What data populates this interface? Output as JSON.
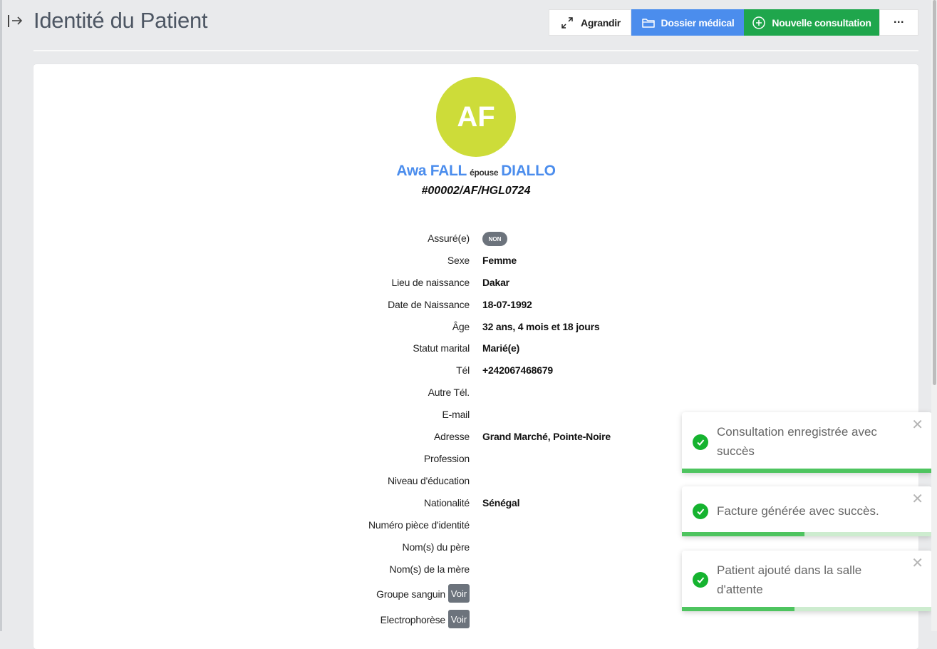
{
  "header": {
    "title": "Identité du Patient"
  },
  "toolbar": {
    "agrandir_label": "Agrandir",
    "dossier_label": "Dossier médical",
    "consultation_label": "Nouvelle consultation",
    "more_label": "···"
  },
  "patient": {
    "initials": "AF",
    "first_name": "Awa FALL",
    "epouse_label": "épouse",
    "spouse_name": "DIALLO",
    "id": "#00002/AF/HGL0724"
  },
  "fields": {
    "assure_label": "Assuré(e)",
    "assure_badge": "NON",
    "sexe_label": "Sexe",
    "sexe_value": "Femme",
    "lieu_label": "Lieu de naissance",
    "lieu_value": "Dakar",
    "date_label": "Date de Naissance",
    "date_value": "18-07-1992",
    "age_label": "Âge",
    "age_value": "32 ans, 4 mois et 18 jours",
    "statut_label": "Statut marital",
    "statut_value": "Marié(e)",
    "tel_label": "Tél",
    "tel_value": "+242067468679",
    "autre_tel_label": "Autre Tél.",
    "email_label": "E-mail",
    "adresse_label": "Adresse",
    "adresse_value": "Grand Marché, Pointe-Noire",
    "profession_label": "Profession",
    "niveau_label": "Niveau d'éducation",
    "nationalite_label": "Nationalité",
    "nationalite_value": "Sénégal",
    "piece_label": "Numéro pièce d'identité",
    "pere_label": "Nom(s) du père",
    "mere_label": "Nom(s) de la mère",
    "groupe_label": "Groupe sanguin",
    "electro_label": "Electrophorèse",
    "voir_label": "Voir"
  },
  "toasts": [
    {
      "message": "Consultation enregistrée avec succès",
      "progress": 1.0
    },
    {
      "message": "Facture générée avec succès.",
      "progress": 0.49
    },
    {
      "message": "Patient ajouté dans la salle d'attente",
      "progress": 0.45
    }
  ],
  "colors": {
    "accent_blue": "#4b8ded",
    "success_green": "#1fa64c",
    "avatar_bg": "#cddc39"
  }
}
